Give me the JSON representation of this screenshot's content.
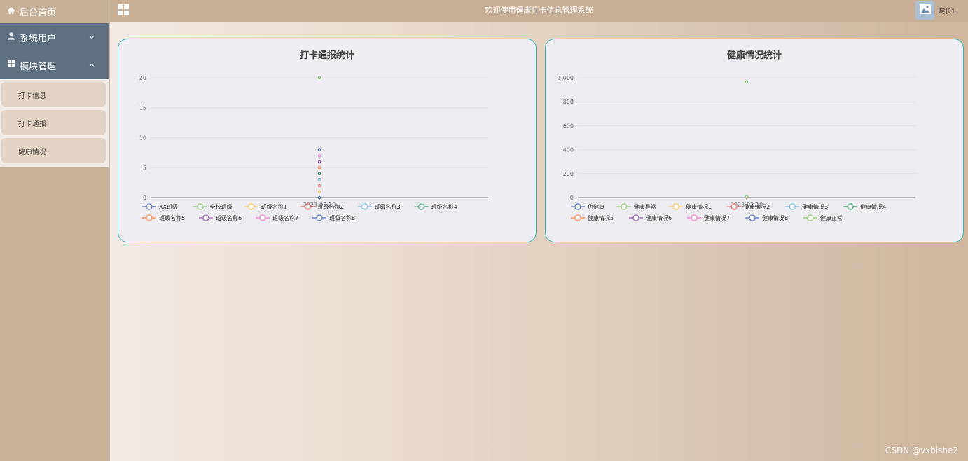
{
  "sidebar": {
    "home_label": "后台首页",
    "users_label": "系统用户",
    "modules_label": "模块管理",
    "sub_items": [
      "打卡信息",
      "打卡通报",
      "健康情况"
    ]
  },
  "header": {
    "title": "欢迎使用健康打卡信息管理系统",
    "username": "院长1"
  },
  "watermark": "CSDN @vxbishe2",
  "icons": [
    "home-icon",
    "user-icon",
    "grid-icon",
    "chevron-down-icon",
    "chevron-up-icon",
    "image-icon"
  ],
  "colors": {
    "palette": [
      "#5470c6",
      "#91cc75",
      "#fac858",
      "#ee6666",
      "#73c0de",
      "#3ba272",
      "#fc8452",
      "#9a60b4",
      "#ea7ccc"
    ]
  },
  "chart_data": [
    {
      "type": "scatter",
      "title": "打卡通报统计",
      "x": [
        "2023-02-10"
      ],
      "ylim": [
        0,
        20
      ],
      "yticks": [
        "0",
        "5",
        "10",
        "15",
        "20"
      ],
      "legend_position": "bottom",
      "grid": true,
      "series": [
        {
          "name": "XX班级",
          "values": [
            0
          ]
        },
        {
          "name": "全校班级",
          "values": [
            20
          ]
        },
        {
          "name": "班级名称1",
          "values": [
            1
          ]
        },
        {
          "name": "班级名称2",
          "values": [
            2
          ]
        },
        {
          "name": "班级名称3",
          "values": [
            3
          ]
        },
        {
          "name": "班级名称4",
          "values": [
            4
          ]
        },
        {
          "name": "班级名称5",
          "values": [
            5
          ]
        },
        {
          "name": "班级名称6",
          "values": [
            6
          ]
        },
        {
          "name": "班级名称7",
          "values": [
            7
          ]
        },
        {
          "name": "班级名称8",
          "values": [
            8
          ]
        }
      ]
    },
    {
      "type": "scatter",
      "title": "健康情况统计",
      "x": [
        "2023-02-10"
      ],
      "ylim": [
        0,
        1000
      ],
      "yticks": [
        "0",
        "200",
        "400",
        "600",
        "800",
        "1,000"
      ],
      "legend_position": "bottom",
      "grid": true,
      "series": [
        {
          "name": "伪健康",
          "values": [
            5
          ]
        },
        {
          "name": "健康异常",
          "values": [
            965
          ]
        },
        {
          "name": "健康情况1",
          "values": [
            1
          ]
        },
        {
          "name": "健康情况2",
          "values": [
            2
          ]
        },
        {
          "name": "健康情况3",
          "values": [
            3
          ]
        },
        {
          "name": "健康情况4",
          "values": [
            4
          ]
        },
        {
          "name": "健康情况5",
          "values": [
            5
          ]
        },
        {
          "name": "健康情况6",
          "values": [
            6
          ]
        },
        {
          "name": "健康情况7",
          "values": [
            7
          ]
        },
        {
          "name": "健康情况8",
          "values": [
            8
          ]
        },
        {
          "name": "健康正常",
          "values": [
            9
          ]
        }
      ]
    }
  ]
}
